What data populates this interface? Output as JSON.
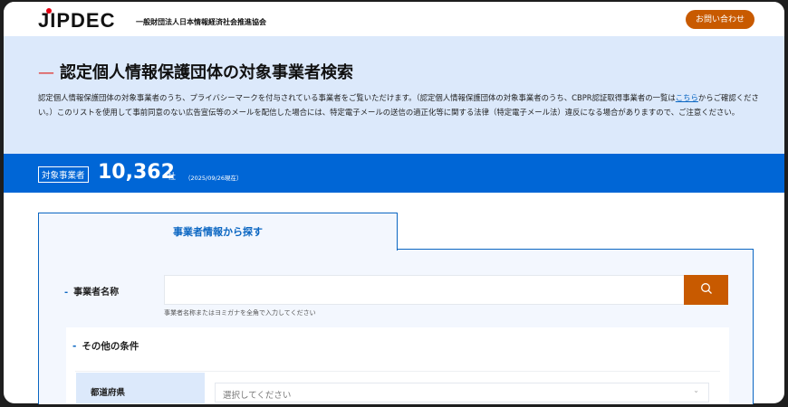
{
  "header": {
    "logo": "JIPDEC",
    "org_name": "一般財団法人日本情報経済社会推進協会",
    "contact_label": "お問い合わせ"
  },
  "hero": {
    "title": "認定個人情報保護団体の対象事業者検索",
    "desc_1": "認定個人情報保護団体の対象事業者のうち、プライバシーマークを付与されている事業者をご覧いただけます。（認定個人情報保護団体の対象事業者のうち、CBPR認証取得事業者の一覧は",
    "desc_link": "こちら",
    "desc_2": "からご確認ください。）このリストを使用して事前同意のない広告宣伝等のメールを配信した場合には、特定電子メールの送信の適正化等に関する法律（特定電子メール法）違反になる場合がありますので、ご注意ください。"
  },
  "count": {
    "tag": "対象事業者",
    "number": "10,362",
    "unit": "社",
    "date": "（2025/09/26現在）"
  },
  "search": {
    "tab_label": "事業者情報から探す",
    "name_label": "事業者名称",
    "name_value": "",
    "name_hint": "事業者名称またはヨミガナを全角で入力してください",
    "other_heading": "その他の条件",
    "pref_label": "都道府県",
    "pref_placeholder": "選択してください"
  },
  "colors": {
    "accent": "#0066d6",
    "button": "#c85a00",
    "hero_bg": "#dce9fb"
  }
}
